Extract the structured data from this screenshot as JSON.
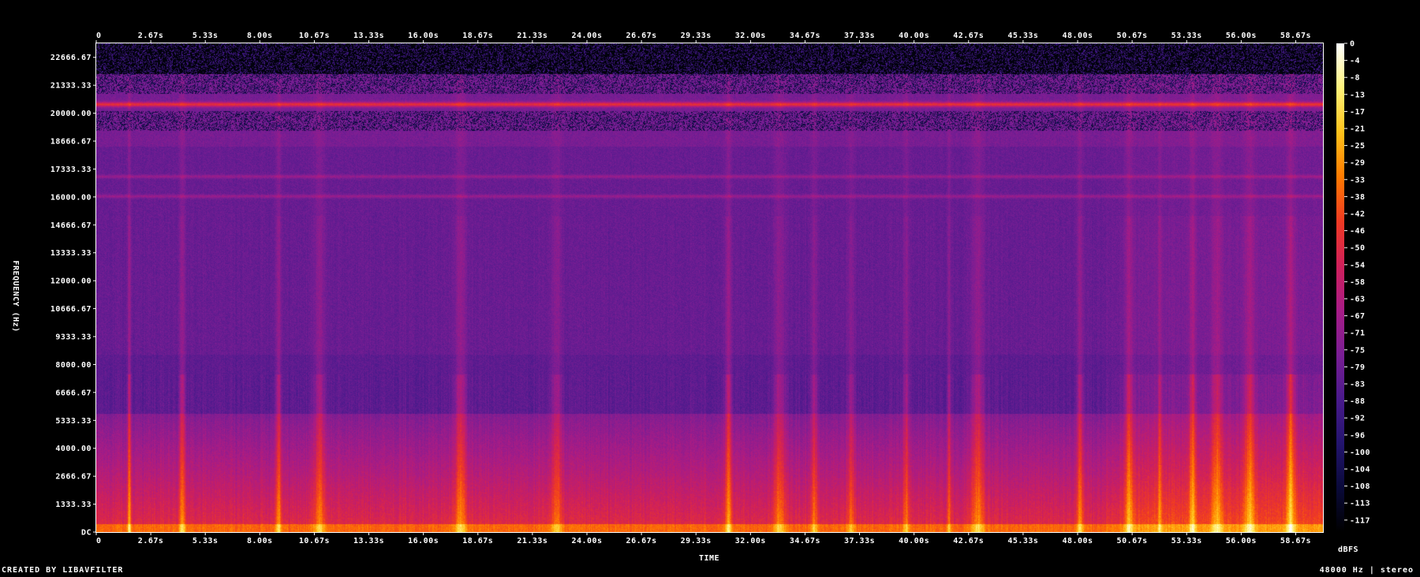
{
  "chart_data": {
    "type": "heatmap",
    "title": "",
    "xlabel": "TIME",
    "ylabel": "FREQUENCY (Hz)",
    "xlim": [
      0,
      60
    ],
    "ylim": [
      0,
      24000
    ],
    "x_ticks": [
      "0",
      "2.67s",
      "5.33s",
      "8.00s",
      "10.67s",
      "13.33s",
      "16.00s",
      "18.67s",
      "21.33s",
      "24.00s",
      "26.67s",
      "29.33s",
      "32.00s",
      "34.67s",
      "37.33s",
      "40.00s",
      "42.67s",
      "45.33s",
      "48.00s",
      "50.67s",
      "53.33s",
      "56.00s",
      "58.67s"
    ],
    "y_ticks": [
      "DC",
      "1333.33",
      "2666.67",
      "4000.00",
      "5333.33",
      "6666.67",
      "8000.00",
      "9333.33",
      "10666.67",
      "12000.00",
      "13333.33",
      "14666.67",
      "16000.00",
      "17333.33",
      "18666.67",
      "20000.00",
      "21333.33",
      "22666.67"
    ],
    "colorbar": {
      "label": "dBFS",
      "range": [
        -120,
        0
      ],
      "ticks": [
        "0",
        "-4",
        "-8",
        "-13",
        "-17",
        "-21",
        "-25",
        "-29",
        "-33",
        "-38",
        "-42",
        "-46",
        "-50",
        "-54",
        "-58",
        "-63",
        "-67",
        "-71",
        "-75",
        "-79",
        "-83",
        "-88",
        "-92",
        "-96",
        "-100",
        "-104",
        "-108",
        "-113",
        "-117"
      ],
      "colors": [
        "#000000",
        "#0a0a3a",
        "#23146e",
        "#4a1a8c",
        "#7a1e94",
        "#a81c86",
        "#d0205a",
        "#f03a22",
        "#ff7a00",
        "#ffc21a",
        "#fff27a",
        "#ffffff"
      ]
    },
    "tonal_lines_hz": [
      21650,
      18000,
      17000
    ],
    "loud_bursts_s": [
      1.6,
      4.2,
      8.9,
      10.9,
      17.8,
      22.5,
      30.9,
      33.4,
      35.1,
      36.9,
      39.6,
      41.7,
      43.1,
      48.1,
      50.5,
      52.0,
      53.6,
      54.8,
      56.4,
      58.4
    ]
  },
  "footer": {
    "credit": "CREATED BY LIBAVFILTER",
    "sample_rate": "48000 Hz | stereo"
  }
}
